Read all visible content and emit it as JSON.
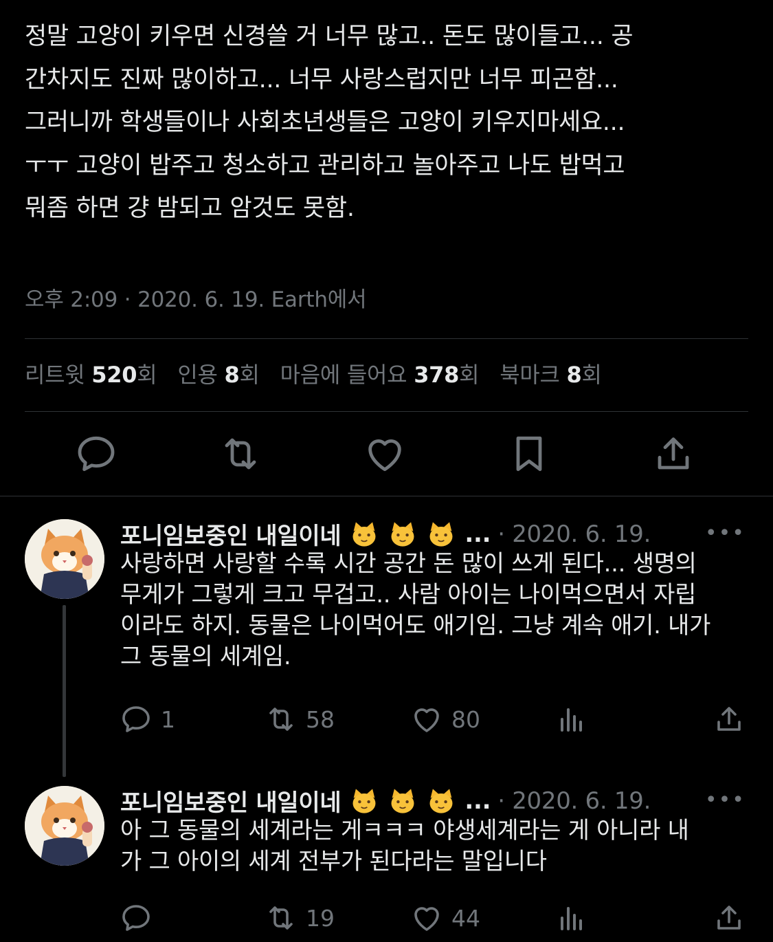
{
  "tweet": {
    "text": "정말 고양이 키우면 신경쓸 거 너무 많고..  돈도 많이들고... 공\n간차지도 진짜 많이하고... 너무 사랑스럽지만 너무 피곤함...\n그러니까 학생들이나 사회초년생들은 고양이 키우지마세요...\nㅜㅜ 고양이 밥주고 청소하고 관리하고 놀아주고 나도 밥먹고\n뭐좀 하면 걍 밤되고 암것도 못함.",
    "meta": "오후 2:09 · 2020. 6. 19. Earth에서"
  },
  "stats": [
    {
      "label": "리트윗",
      "count": "520",
      "suffix": "회"
    },
    {
      "label": "인용",
      "count": "8",
      "suffix": "회"
    },
    {
      "label": "마음에 들어요",
      "count": "378",
      "suffix": "회"
    },
    {
      "label": "북마크",
      "count": "8",
      "suffix": "회"
    }
  ],
  "actions": [
    "reply-icon",
    "retweet-icon",
    "heart-icon",
    "bookmark-icon",
    "share-icon"
  ],
  "replies": [
    {
      "name": "포니임보중인 내일이네",
      "emojis": [
        "cat-face-icon",
        "cat-face-icon",
        "cat-face-icon"
      ],
      "ellipsis": "...",
      "date": "· 2020. 6. 19.",
      "more": "•••",
      "text": "사랑하면 사랑할 수록 시간 공간 돈 많이 쓰게 된다... 생명의\n무게가 그렇게 크고 무겁고.. 사람 아이는 나이먹으면서 자립\n이라도 하지. 동물은 나이먹어도 애기임. 그냥 계속 애기. 내가\n그 동물의 세계임.",
      "reply_count": "1",
      "retweet_count": "58",
      "like_count": "80"
    },
    {
      "name": "포니임보중인 내일이네",
      "emojis": [
        "cat-face-icon",
        "cat-face-icon",
        "cat-face-icon"
      ],
      "ellipsis": "...",
      "date": "· 2020. 6. 19.",
      "more": "•••",
      "text": "아 그 동물의 세계라는 게ㅋㅋㅋ 야생세계라는 게 아니라 내\n가 그 아이의 세계 전부가 된다라는 말입니다",
      "reply_count": "",
      "retweet_count": "19",
      "like_count": "44"
    }
  ],
  "colors": {
    "background": "#000000",
    "text": "#e7e9ea",
    "secondary": "#71767b",
    "divider": "#2f3336"
  }
}
